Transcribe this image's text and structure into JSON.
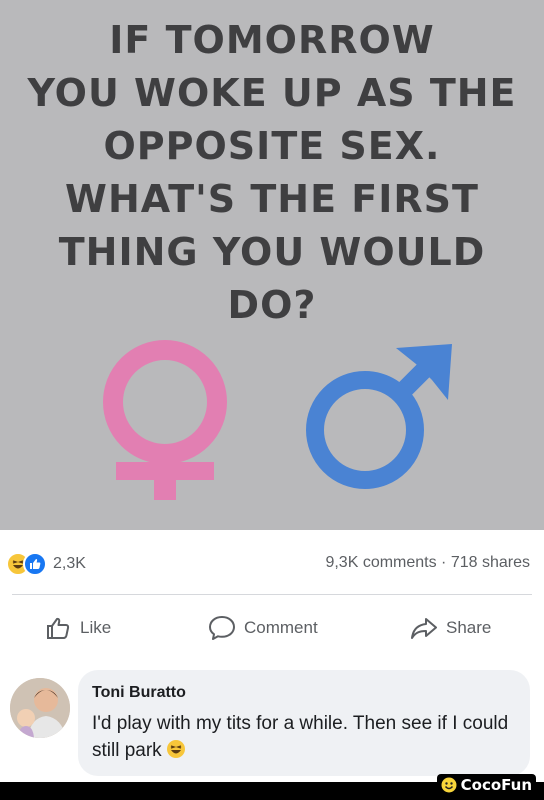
{
  "meme": {
    "lines": [
      "IF TOMORROW",
      "YOU WOKE UP AS THE",
      "OPPOSITE SEX.",
      "WHAT'S THE FIRST",
      "THING YOU WOULD",
      "DO?"
    ],
    "female_symbol_color": "#e27fb2",
    "male_symbol_color": "#4a83d3"
  },
  "post": {
    "reactions": [
      "haha-icon",
      "like-icon"
    ],
    "reaction_count": "2,3K",
    "share_stats": "9,3K comments · 718 shares",
    "actions": {
      "like_label": "Like",
      "comment_label": "Comment",
      "share_label": "Share"
    }
  },
  "comment": {
    "author": "Toni Buratto",
    "text": "I'd play with my tits for a while. Then see if I could still park",
    "emoji": "laughing-emoji"
  },
  "watermark": {
    "text": "CocoFun"
  }
}
